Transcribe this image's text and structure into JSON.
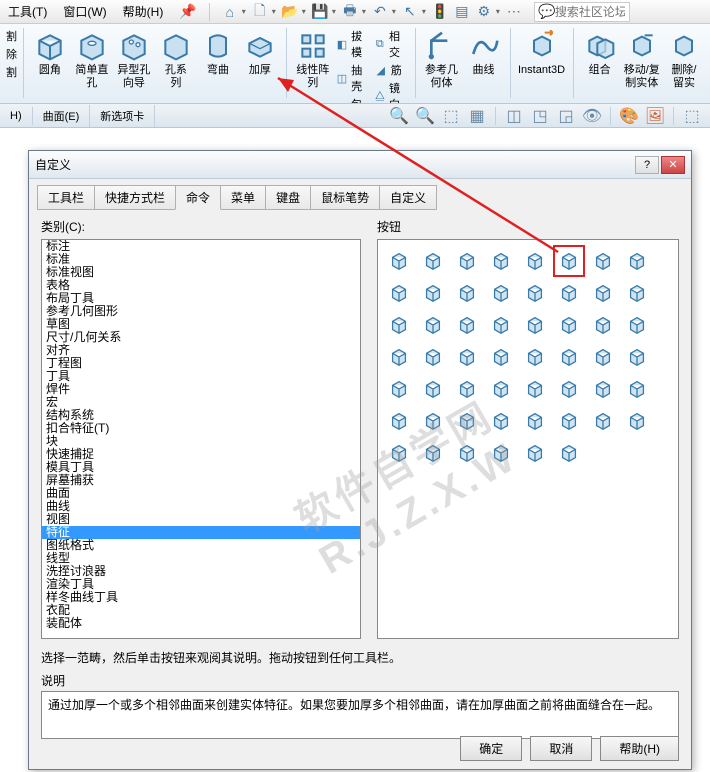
{
  "menu": {
    "tools": "工具(T)",
    "window": "窗口(W)",
    "help": "帮助(H)"
  },
  "search": {
    "placeholder": "搜索社区论坛"
  },
  "ribbon": {
    "cut1": "割",
    "remove": "除",
    "cut2": "割",
    "fillet": "圆角",
    "simple_hole": "简单直\n孔",
    "special_hole": "异型孔\n向导",
    "hole_series": "孔系列",
    "bend": "弯曲",
    "thicken": "加厚",
    "linear_pattern": "线性阵\n列",
    "draft": "拔模",
    "intersect": "相交",
    "shell": "抽壳",
    "rib": "筋",
    "wrap": "包覆",
    "mirror": "镜向",
    "ref_geom": "参考几\n何体",
    "curve": "曲线",
    "instant3d": "Instant3D",
    "combine": "组合",
    "move_copy": "移动/复\n制实体",
    "delete_keep": "删除/\n留实"
  },
  "tabs": {
    "h": "H)",
    "surface": "曲面(E)",
    "newtab": "新选项卡"
  },
  "dialog": {
    "title": "自定义",
    "tabs": [
      "工具栏",
      "快捷方式栏",
      "命令",
      "菜单",
      "键盘",
      "鼠标笔势",
      "自定义"
    ],
    "active_tab": 2,
    "category_label": "类别(C):",
    "categories": [
      "标注",
      "标准",
      "标准视图",
      "表格",
      "布局丁具",
      "参考几何图形",
      "草图",
      "尺寸/几何关系",
      "对齐",
      "丁程图",
      "丁具",
      "焊件",
      "宏",
      "结构系统",
      "扣合特征(T)",
      "块",
      "快速捕捉",
      "模具丁具",
      "屏墓捕获",
      "曲面",
      "曲线",
      "视图",
      "特征",
      "图纸格式",
      "线型",
      "洗挃讨浪器",
      "渲染丁具",
      "样冬曲线丁具",
      "衣配",
      "装配体"
    ],
    "selected_category_index": 22,
    "buttons_label": "按钮",
    "hint": "选择一范畴，然后单击按钮来观阅其说明。拖动按钮到任何工具栏。",
    "desc_label": "说明",
    "desc_text": "通过加厚一个或多个相邻曲面来创建实体特征。如果您要加厚多个相邻曲面，请在加厚曲面之前将曲面缝合在一起。",
    "ok": "确定",
    "cancel": "取消",
    "help": "帮助(H)"
  },
  "watermark": "软件自学网 R.J.Z.X.W"
}
